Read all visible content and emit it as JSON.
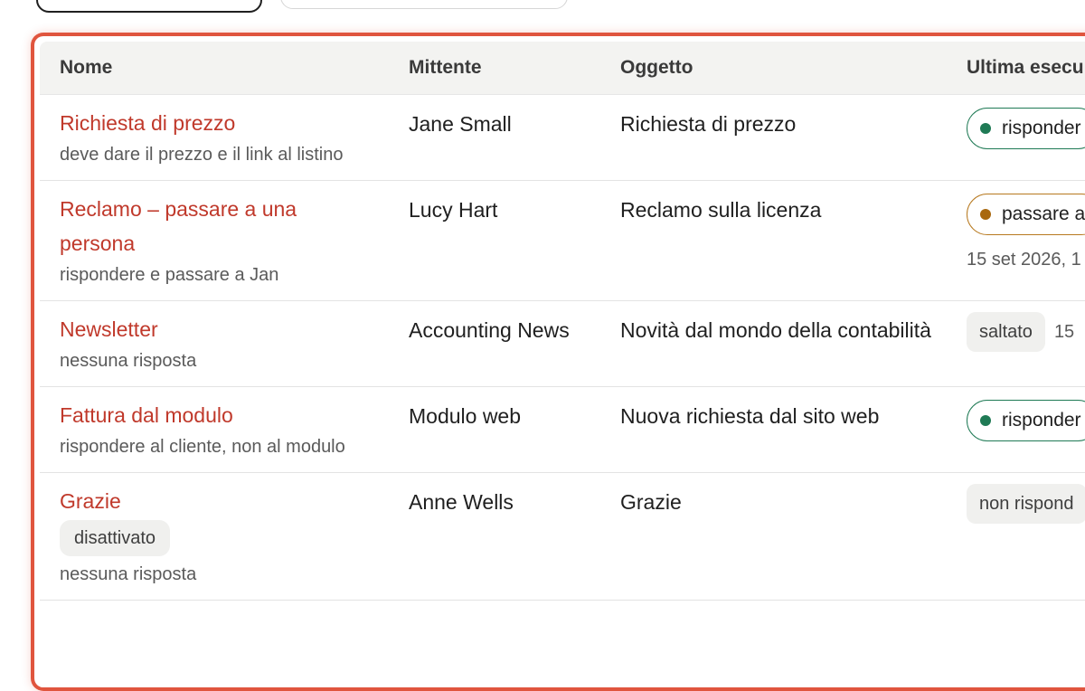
{
  "table": {
    "headers": {
      "name": "Nome",
      "sender": "Mittente",
      "subject": "Oggetto",
      "last_run": "Ultima esecu"
    },
    "rows": [
      {
        "name": "Richiesta di prezzo",
        "description": "deve dare il prezzo e il link al listino",
        "sender": "Jane Small",
        "subject": "Richiesta di prezzo",
        "status": "risponder",
        "status_kind": "green",
        "date": ""
      },
      {
        "name": "Reclamo – passare a una persona",
        "description": "rispondere e passare a Jan",
        "sender": "Lucy Hart",
        "subject": "Reclamo sulla licenza",
        "status": "passare a",
        "status_kind": "amber",
        "date": "15 set 2026, 1"
      },
      {
        "name": "Newsletter",
        "description": "nessuna risposta",
        "sender": "Accounting News",
        "subject": "Novità dal mondo della contabilità",
        "status": "saltato",
        "status_kind": "grey-inline",
        "date": "15"
      },
      {
        "name": "Fattura dal modulo",
        "description": "rispondere al cliente, non al modulo",
        "sender": "Modulo web",
        "subject": "Nuova richiesta dal sito web",
        "status": "risponder",
        "status_kind": "green",
        "date": ""
      },
      {
        "name": "Grazie",
        "tag": "disattivato",
        "description": "nessuna risposta",
        "sender": "Anne Wells",
        "subject": "Grazie",
        "status": "non rispond",
        "status_kind": "grey",
        "date": ""
      }
    ]
  },
  "colors": {
    "accent": "#c0392b",
    "frame": "#e0553e",
    "status_green": "#1f7a55",
    "status_amber": "#b7791f"
  }
}
